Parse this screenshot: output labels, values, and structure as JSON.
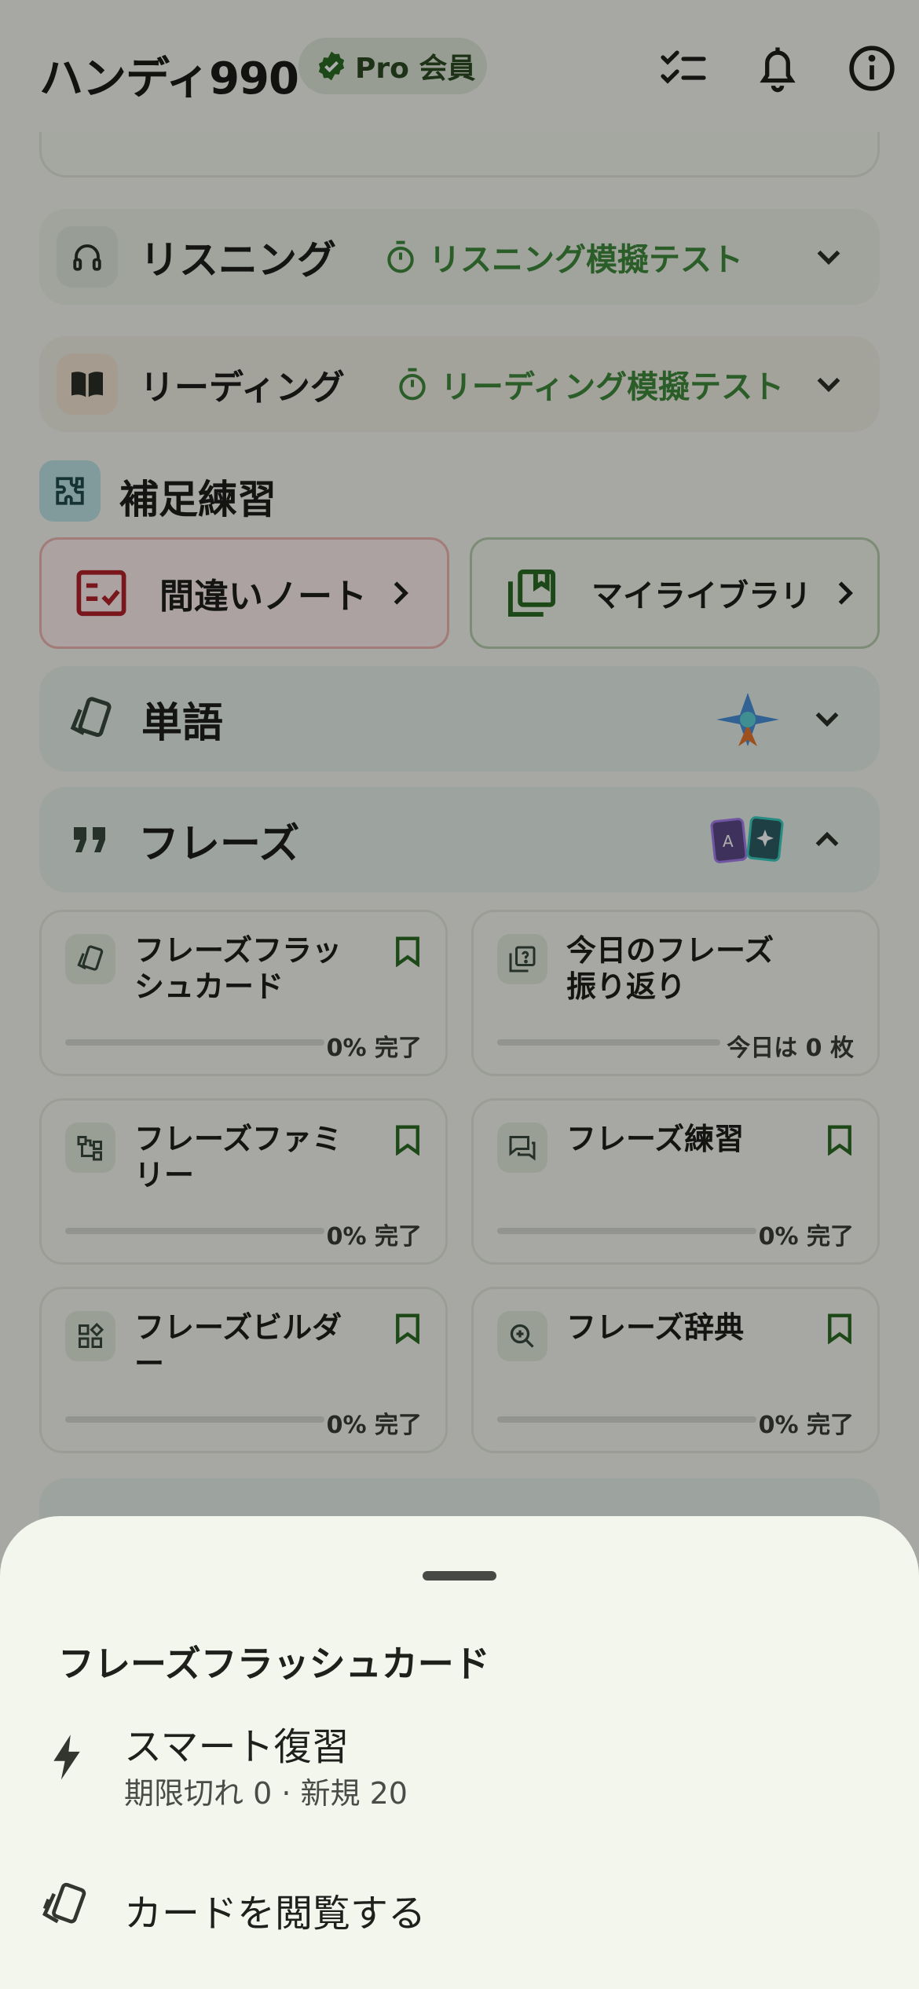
{
  "header": {
    "title": "ハンディ990",
    "badge": "Pro 会員"
  },
  "sections": {
    "listening": {
      "label": "リスニング",
      "test": "リスニング模擬テスト"
    },
    "reading": {
      "label": "リーディング",
      "test": "リーディング模擬テスト"
    }
  },
  "supplementary": {
    "title": "補足練習",
    "mistakes_label": "間違いノート",
    "library_label": "マイライブラリ"
  },
  "vocab": {
    "label": "単語"
  },
  "phrases": {
    "label": "フレーズ",
    "tiles": [
      {
        "name": "フレーズフラッシュカード",
        "status": "0% 完了",
        "progress": 0
      },
      {
        "name": "今日のフレーズ振り返り",
        "status": "今日は 0 枚",
        "progress": 0
      },
      {
        "name": "フレーズファミリー",
        "status": "0% 完了",
        "progress": 0
      },
      {
        "name": "フレーズ練習",
        "status": "0% 完了",
        "progress": 0
      },
      {
        "name": "フレーズビルダー",
        "status": "0% 完了",
        "progress": 0
      },
      {
        "name": "フレーズ辞典",
        "status": "0% 完了",
        "progress": 0
      }
    ]
  },
  "sheet": {
    "title": "フレーズフラッシュカード",
    "smart_review": "スマート復習",
    "smart_review_sub": "期限切れ 0 · 新規 20",
    "browse": "カードを閲覧する"
  }
}
